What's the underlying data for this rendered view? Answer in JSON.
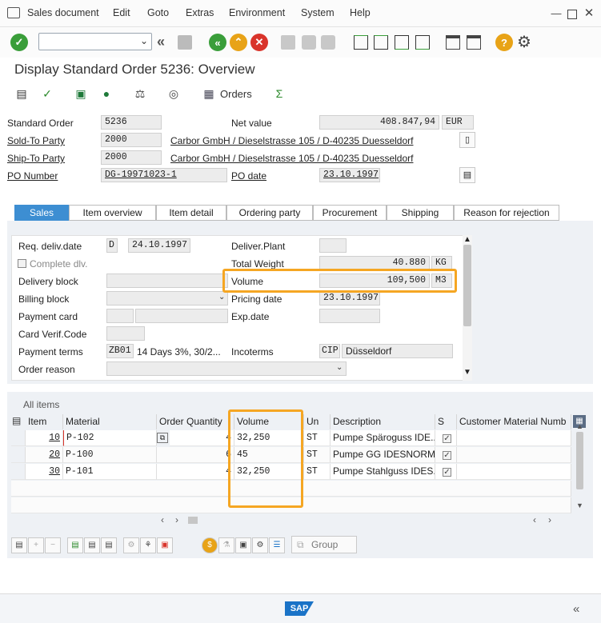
{
  "menu": {
    "items": [
      "Sales document",
      "Edit",
      "Goto",
      "Extras",
      "Environment",
      "System",
      "Help"
    ]
  },
  "window": {
    "title": "Display Standard Order 5236: Overview"
  },
  "toolbar2": {
    "orders_label": "Orders"
  },
  "header": {
    "standard_order_label": "Standard Order",
    "standard_order_value": "5236",
    "net_value_label": "Net value",
    "net_value": "408.847,94",
    "currency": "EUR",
    "sold_to_label": "Sold-To Party",
    "sold_to_value": "2000",
    "sold_to_name": "Carbor GmbH / Dieselstrasse 105 / D-40235 Duesseldorf",
    "ship_to_label": "Ship-To Party",
    "ship_to_value": "2000",
    "ship_to_name": "Carbor GmbH / Dieselstrasse 105 / D-40235 Duesseldorf",
    "po_number_label": "PO Number",
    "po_number_value": "DG-19971023-1",
    "po_date_label": "PO date",
    "po_date_value": "23.10.1997"
  },
  "tabs": [
    "Sales",
    "Item overview",
    "Item detail",
    "Ordering party",
    "Procurement",
    "Shipping",
    "Reason for rejection"
  ],
  "sales": {
    "req_deliv_label": "Req. deliv.date",
    "req_deliv_type": "D",
    "req_deliv_value": "24.10.1997",
    "deliver_plant_label": "Deliver.Plant",
    "complete_dlv_label": "Complete dlv.",
    "total_weight_label": "Total Weight",
    "total_weight_value": "40.880",
    "total_weight_unit": "KG",
    "delivery_block_label": "Delivery block",
    "volume_label": "Volume",
    "volume_value": "109,500",
    "volume_unit": "M3",
    "billing_block_label": "Billing block",
    "pricing_date_label": "Pricing date",
    "pricing_date_value": "23.10.1997",
    "payment_card_label": "Payment card",
    "exp_date_label": "Exp.date",
    "card_verif_label": "Card Verif.Code",
    "payment_terms_label": "Payment terms",
    "payment_terms_code": "ZB01",
    "payment_terms_text": "14 Days 3%, 30/2...",
    "incoterms_label": "Incoterms",
    "incoterms_code": "CIP",
    "incoterms_place": "Düsseldorf",
    "order_reason_label": "Order reason"
  },
  "items": {
    "title": "All items",
    "columns": [
      "Item",
      "Material",
      "Order Quantity",
      "Volume",
      "Un",
      "Description",
      "S",
      "Customer Material Numb"
    ],
    "rows": [
      {
        "item": "10",
        "material": "P-102",
        "qty": "4",
        "volume": "32,250",
        "un": "ST",
        "desc": "Pumpe Späroguss IDE..."
      },
      {
        "item": "20",
        "material": "P-100",
        "qty": "6",
        "volume": "45",
        "un": "ST",
        "desc": "Pumpe GG IDESNORM..."
      },
      {
        "item": "30",
        "material": "P-101",
        "qty": "4",
        "volume": "32,250",
        "un": "ST",
        "desc": "Pumpe Stahlguss IDES..."
      }
    ],
    "group_label": "Group"
  },
  "status": {
    "logo_text": "SAP"
  }
}
